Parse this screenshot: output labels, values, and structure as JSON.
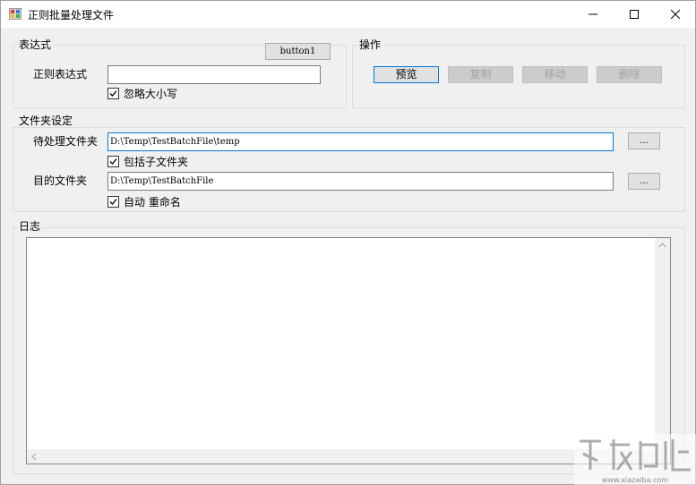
{
  "window": {
    "title": "正则批量处理文件",
    "minimize_icon": "minimize-icon",
    "maximize_icon": "maximize-icon",
    "close_icon": "close-icon"
  },
  "expression_group": {
    "label": "表达式",
    "regex_label": "正则表达式",
    "regex_value": "",
    "button1_label": "button1",
    "ignore_case_label": "忽略大小写",
    "ignore_case_checked": true
  },
  "operations_group": {
    "label": "操作",
    "preview_label": "预览",
    "copy_label": "复制",
    "move_label": "移动",
    "delete_label": "删除"
  },
  "folder_group": {
    "label": "文件夹设定",
    "source_label": "待处理文件夹",
    "source_value": "D:\\Temp\\TestBatchFile\\temp",
    "source_browse_label": "...",
    "include_sub_label": "包括子文件夹",
    "include_sub_checked": true,
    "target_label": "目的文件夹",
    "target_value": "D:\\Temp\\TestBatchFile",
    "target_browse_label": "...",
    "auto_rename_label": "自动 重命名",
    "auto_rename_checked": true
  },
  "log_group": {
    "label": "日志",
    "content": ""
  },
  "watermark": {
    "site": "www.xiazaiba.com"
  }
}
